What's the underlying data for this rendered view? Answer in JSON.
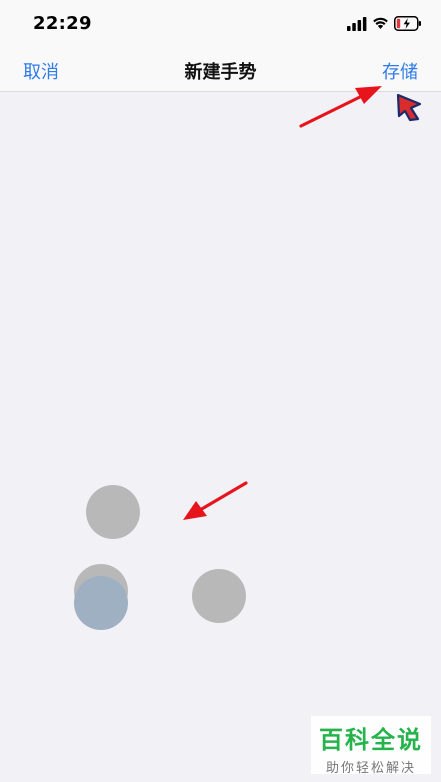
{
  "status_bar": {
    "time": "22:29",
    "icons": [
      "cellular-signal-icon",
      "wifi-icon",
      "battery-charging-icon"
    ],
    "battery_color": "#e0383e"
  },
  "nav": {
    "cancel_label": "取消",
    "title": "新建手势",
    "save_label": "存储"
  },
  "canvas": {
    "touch_points": [
      {
        "id": "touch-point-1",
        "color": "gray"
      },
      {
        "id": "touch-point-2",
        "color": "gray"
      },
      {
        "id": "touch-point-3",
        "color": "blue"
      },
      {
        "id": "touch-point-4",
        "color": "gray"
      }
    ]
  },
  "annotations": {
    "arrow_color": "#e8141c",
    "cursor_icon": "mouse-pointer-icon"
  },
  "watermark": {
    "title": "百科全说",
    "subtitle": "助你轻松解决"
  },
  "colors": {
    "accent": "#2f7bea",
    "background": "#f2f1f6",
    "touch_gray": "#b8b8b8",
    "touch_blue": "#9eb0c2"
  }
}
